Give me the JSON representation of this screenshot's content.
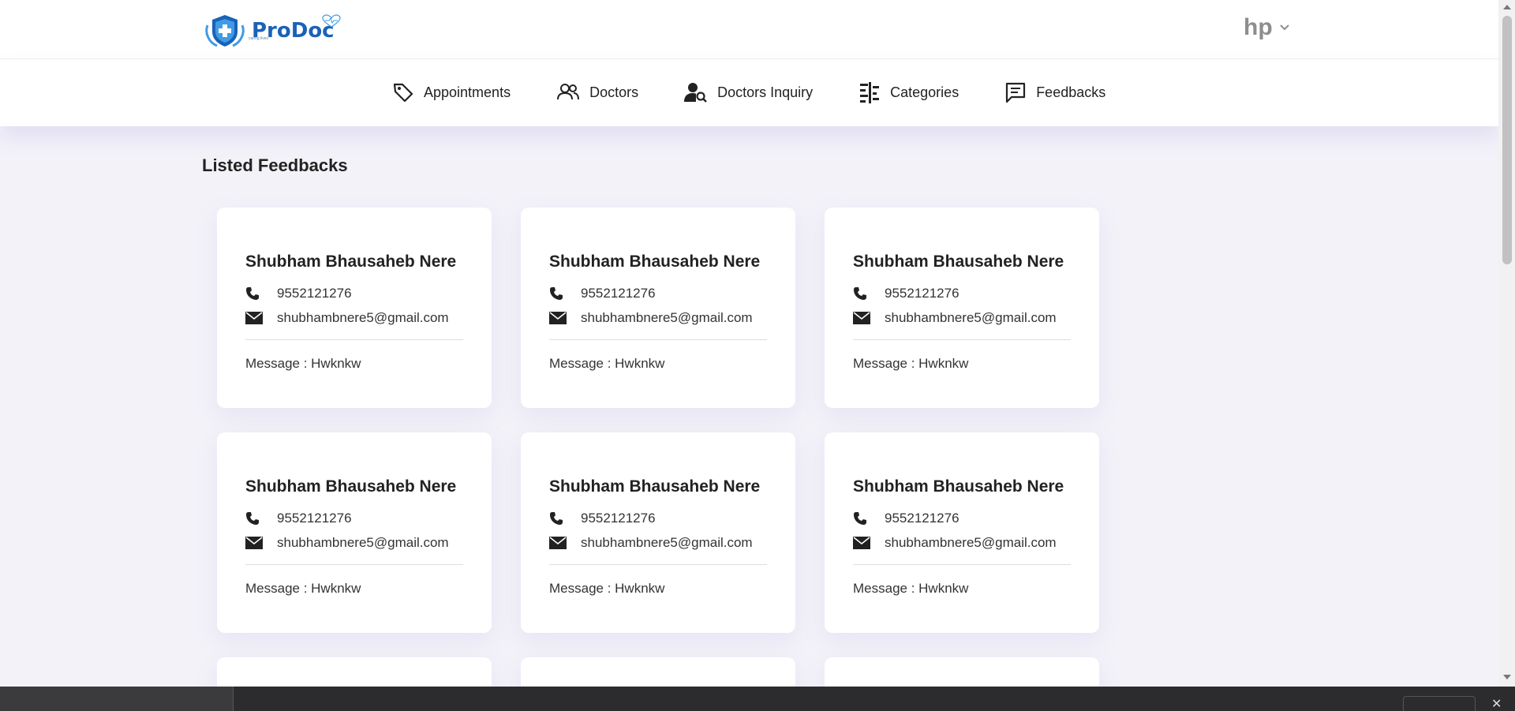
{
  "header": {
    "logo_text": "ProDoc",
    "logo_tagline": "caring lives",
    "user_name": "hp"
  },
  "nav": {
    "items": [
      {
        "label": "Appointments",
        "icon": "tag-icon"
      },
      {
        "label": "Doctors",
        "icon": "users-icon"
      },
      {
        "label": "Doctors Inquiry",
        "icon": "user-search-icon"
      },
      {
        "label": "Categories",
        "icon": "list-sliders-icon"
      },
      {
        "label": "Feedbacks",
        "icon": "message-square-icon"
      }
    ]
  },
  "main": {
    "title": "Listed Feedbacks",
    "feedbacks": [
      {
        "name": "Shubham Bhausaheb Nere",
        "phone": "9552121276",
        "email": "shubhambnere5@gmail.com",
        "message": "Message : Hwknkw"
      },
      {
        "name": "Shubham Bhausaheb Nere",
        "phone": "9552121276",
        "email": "shubhambnere5@gmail.com",
        "message": "Message : Hwknkw"
      },
      {
        "name": "Shubham Bhausaheb Nere",
        "phone": "9552121276",
        "email": "shubhambnere5@gmail.com",
        "message": "Message : Hwknkw"
      },
      {
        "name": "Shubham Bhausaheb Nere",
        "phone": "9552121276",
        "email": "shubhambnere5@gmail.com",
        "message": "Message : Hwknkw"
      },
      {
        "name": "Shubham Bhausaheb Nere",
        "phone": "9552121276",
        "email": "shubhambnere5@gmail.com",
        "message": "Message : Hwknkw"
      },
      {
        "name": "Shubham Bhausaheb Nere",
        "phone": "9552121276",
        "email": "shubhambnere5@gmail.com",
        "message": "Message : Hwknkw"
      }
    ]
  },
  "colors": {
    "brand": "#1a62b8",
    "background": "#f3f2f8",
    "card": "#ffffff"
  }
}
